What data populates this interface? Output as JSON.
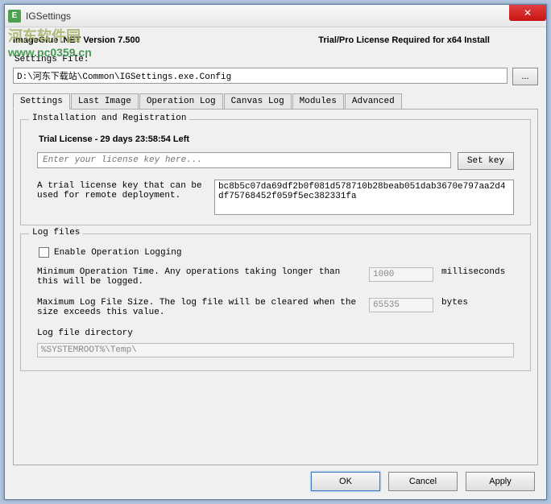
{
  "window": {
    "title": "IGSettings",
    "icon_letter": "E"
  },
  "watermark": {
    "title": "河东软件园",
    "url": "www.pc0359.cn"
  },
  "header": {
    "version": "ImageGlue .NET Version 7.500",
    "trial_notice": "Trial/Pro License Required for x64 Install"
  },
  "settings_file": {
    "label": "Settings File:",
    "path": "D:\\河东下载站\\Common\\IGSettings.exe.Config",
    "browse_label": "..."
  },
  "tabs": [
    {
      "id": "settings",
      "label": "Settings",
      "active": true
    },
    {
      "id": "last-image",
      "label": "Last Image",
      "active": false
    },
    {
      "id": "operation-log",
      "label": "Operation Log",
      "active": false
    },
    {
      "id": "canvas-log",
      "label": "Canvas Log",
      "active": false
    },
    {
      "id": "modules",
      "label": "Modules",
      "active": false
    },
    {
      "id": "advanced",
      "label": "Advanced",
      "active": false
    }
  ],
  "installation": {
    "group_title": "Installation and Registration",
    "trial_label": "Trial License - 29 days 23:58:54 Left",
    "license_placeholder": "Enter your license key here...",
    "set_key_label": "Set key",
    "trial_desc": "A trial license key that can be used for remote deployment.",
    "trial_key": "bc8b5c07da69df2b0f081d578710b28beab051dab3670e797aa2d4df75768452f059f5ec382331fa"
  },
  "log_files": {
    "group_title": "Log files",
    "enable_label": "Enable Operation Logging",
    "min_time_desc": "Minimum Operation Time. Any operations taking longer than this will be logged.",
    "min_time_value": "1000",
    "min_time_unit": "milliseconds",
    "max_size_desc": "Maximum Log File Size. The log file will be cleared when the size exceeds this value.",
    "max_size_value": "65535",
    "max_size_unit": "bytes",
    "dir_label": "Log file directory",
    "dir_value": "%SYSTEMROOT%\\Temp\\"
  },
  "buttons": {
    "ok": "OK",
    "cancel": "Cancel",
    "apply": "Apply"
  }
}
